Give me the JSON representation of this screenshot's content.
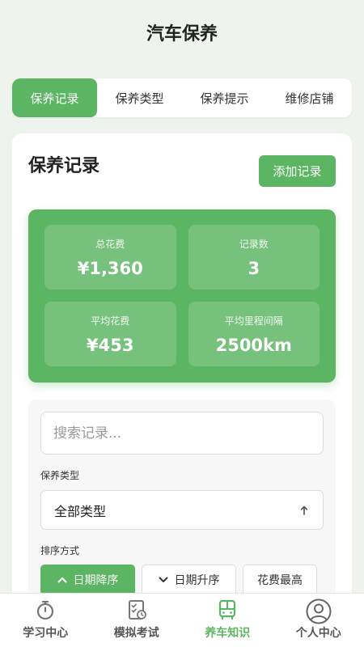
{
  "header": {
    "title": "汽车保养"
  },
  "tabs": [
    {
      "label": "保养记录",
      "active": true
    },
    {
      "label": "保养类型",
      "active": false
    },
    {
      "label": "保养提示",
      "active": false
    },
    {
      "label": "维修店铺",
      "active": false
    }
  ],
  "records": {
    "title": "保养记录",
    "add_label": "添加记录",
    "stats": [
      {
        "label": "总花费",
        "value": "¥1,360"
      },
      {
        "label": "记录数",
        "value": "3"
      },
      {
        "label": "平均花费",
        "value": "¥453"
      },
      {
        "label": "平均里程间隔",
        "value": "2500km"
      }
    ],
    "filter": {
      "search_placeholder": "搜索记录...",
      "type_label": "保养类型",
      "type_selected": "全部类型",
      "sort_label": "排序方式",
      "sort_options": [
        {
          "label": "日期降序",
          "icon": "chevron-up-icon",
          "active": true
        },
        {
          "label": "日期升序",
          "icon": "chevron-down-icon",
          "active": false
        },
        {
          "label": "花费最高",
          "icon": "",
          "active": false
        }
      ]
    }
  },
  "colors": {
    "accent": "#5cb562",
    "background": "#eef3ee"
  },
  "bottom_nav": [
    {
      "label": "学习中心",
      "icon": "stopwatch-icon",
      "active": false
    },
    {
      "label": "模拟考试",
      "icon": "exam-clipboard-icon",
      "active": false
    },
    {
      "label": "养车知识",
      "icon": "car-icon",
      "active": true
    },
    {
      "label": "个人中心",
      "icon": "user-icon",
      "active": false
    }
  ]
}
